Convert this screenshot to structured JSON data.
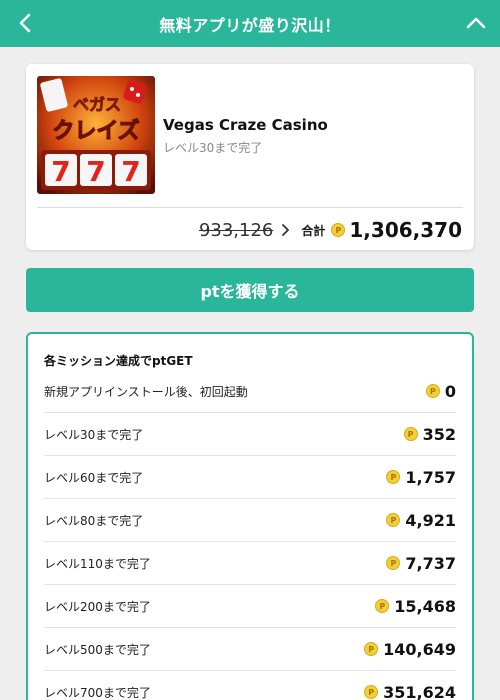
{
  "header": {
    "title": "無料アプリが盛り沢山！"
  },
  "app": {
    "icon_text_top": "ベガス",
    "icon_text_mid": "クレイズ",
    "icon_text_reels": [
      "7",
      "7",
      "7"
    ],
    "name": "Vegas Craze Casino",
    "subtitle": "レベル30まで完了",
    "old_points": "933,126",
    "total_label": "合計",
    "total_points": "1,306,370"
  },
  "cta": {
    "label": "ptを獲得する"
  },
  "missions": {
    "title": "各ミッション達成でptGET",
    "items": [
      {
        "label": "新規アプリインストール後、初回起動",
        "points": "0"
      },
      {
        "label": "レベル30まで完了",
        "points": "352"
      },
      {
        "label": "レベル60まで完了",
        "points": "1,757"
      },
      {
        "label": "レベル80まで完了",
        "points": "4,921"
      },
      {
        "label": "レベル110まで完了",
        "points": "7,737"
      },
      {
        "label": "レベル200まで完了",
        "points": "15,468"
      },
      {
        "label": "レベル500まで完了",
        "points": "140,649"
      },
      {
        "label": "レベル700まで完了",
        "points": "351,624"
      }
    ]
  },
  "coin_symbol": "P",
  "colors": {
    "accent": "#2ab69a",
    "coin": "#f2cf3a",
    "background": "#eeeeee"
  },
  "icons": {
    "back": "chevron-left-icon",
    "collapse": "chevron-up-icon",
    "arrow": "chevron-right-icon",
    "coin": "coin-icon"
  }
}
